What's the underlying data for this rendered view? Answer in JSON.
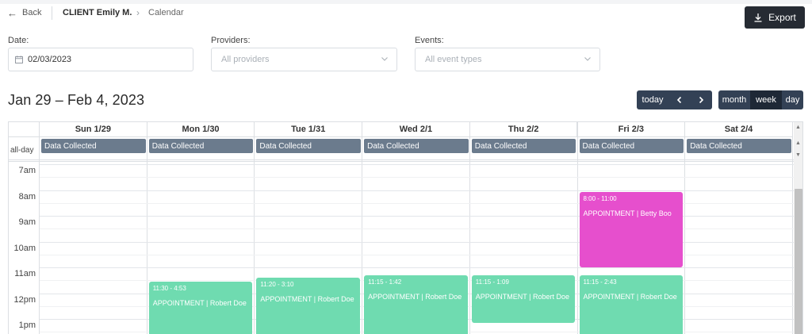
{
  "header": {
    "back_label": "Back",
    "client": "CLIENT Emily M.",
    "page": "Calendar",
    "export_label": "Export"
  },
  "filters": {
    "date_label": "Date:",
    "date_value": "02/03/2023",
    "providers_label": "Providers:",
    "providers_placeholder": "All providers",
    "events_label": "Events:",
    "events_placeholder": "All event types"
  },
  "toolbar": {
    "range_title": "Jan 29 – Feb 4, 2023",
    "today_label": "today",
    "prev_icon": "chevron-left-icon",
    "next_icon": "chevron-right-icon",
    "views": [
      "month",
      "week",
      "day"
    ],
    "active_view": "week"
  },
  "calendar": {
    "days": [
      "Sun 1/29",
      "Mon 1/30",
      "Tue 1/31",
      "Wed 2/1",
      "Thu 2/2",
      "Fri 2/3",
      "Sat 2/4"
    ],
    "allday_label": "all-day",
    "allday_event": "Data Collected",
    "hours": [
      "7am",
      "8am",
      "9am",
      "10am",
      "11am",
      "12pm",
      "1pm"
    ],
    "appointments": [
      {
        "day": 5,
        "time": "8:00 - 11:00",
        "title": "APPOINTMENT | Betty Boo",
        "color": "#e64fcd"
      },
      {
        "day": 1,
        "time": "11:30 - 4:53",
        "title": "APPOINTMENT | Robert Doe",
        "color": "#6fdbb0"
      },
      {
        "day": 2,
        "time": "11:20 - 3:10",
        "title": "APPOINTMENT | Robert Doe",
        "color": "#6fdbb0"
      },
      {
        "day": 3,
        "time": "11:15 - 1:42",
        "title": "APPOINTMENT | Robert Doe",
        "color": "#6fdbb0"
      },
      {
        "day": 4,
        "time": "11:15 - 1:09",
        "title": "APPOINTMENT | Robert Doe",
        "color": "#6fdbb0"
      },
      {
        "day": 5,
        "time": "11:15 - 2:43",
        "title": "APPOINTMENT | Robert Doe",
        "color": "#6fdbb0"
      }
    ]
  },
  "colors": {
    "dark_button": "#334155",
    "active_button": "#1e2836",
    "allday_event": "#6b7b8d",
    "export_button": "#262b33"
  }
}
